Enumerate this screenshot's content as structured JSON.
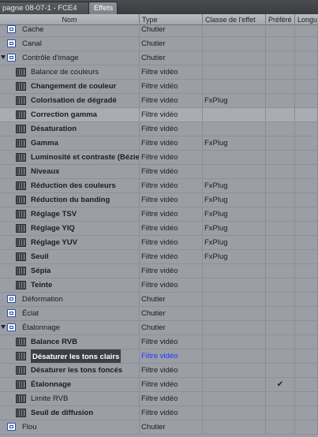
{
  "tabs": [
    {
      "label": "pagne 08-07-1 - FCE4",
      "active": false
    },
    {
      "label": "Effets",
      "active": true
    }
  ],
  "columns": [
    "Nom",
    "Type",
    "Classe de l'effet",
    "Préféré",
    "Longu"
  ],
  "rows": [
    {
      "name": "Cache",
      "type": "Chutier",
      "class": "",
      "pref": "",
      "kind": "bin",
      "level": 0,
      "bold": false
    },
    {
      "name": "Canal",
      "type": "Chutier",
      "class": "",
      "pref": "",
      "kind": "bin",
      "level": 0,
      "bold": false
    },
    {
      "name": "Contrôle d'image",
      "type": "Chutier",
      "class": "",
      "pref": "",
      "kind": "bin-open",
      "level": 0,
      "bold": false
    },
    {
      "name": "Balance de couleurs",
      "type": "Filtre vidéo",
      "class": "",
      "pref": "",
      "kind": "fx",
      "level": 1,
      "bold": false
    },
    {
      "name": "Changement de couleur",
      "type": "Filtre vidéo",
      "class": "",
      "pref": "",
      "kind": "fx",
      "level": 1,
      "bold": true
    },
    {
      "name": "Colorisation de dégradé",
      "type": "Filtre vidéo",
      "class": "FxPlug",
      "pref": "",
      "kind": "fx",
      "level": 1,
      "bold": true
    },
    {
      "name": "Correction gamma",
      "type": "Filtre vidéo",
      "class": "",
      "pref": "",
      "kind": "fx",
      "level": 1,
      "bold": true,
      "hl": true
    },
    {
      "name": "Désaturation",
      "type": "Filtre vidéo",
      "class": "",
      "pref": "",
      "kind": "fx",
      "level": 1,
      "bold": true
    },
    {
      "name": "Gamma",
      "type": "Filtre vidéo",
      "class": "FxPlug",
      "pref": "",
      "kind": "fx",
      "level": 1,
      "bold": true
    },
    {
      "name": "Luminosité et contraste (Bézie",
      "type": "Filtre vidéo",
      "class": "",
      "pref": "",
      "kind": "fx",
      "level": 1,
      "bold": true
    },
    {
      "name": "Niveaux",
      "type": "Filtre vidéo",
      "class": "",
      "pref": "",
      "kind": "fx",
      "level": 1,
      "bold": true
    },
    {
      "name": "Réduction des couleurs",
      "type": "Filtre vidéo",
      "class": "FxPlug",
      "pref": "",
      "kind": "fx",
      "level": 1,
      "bold": true
    },
    {
      "name": "Réduction du banding",
      "type": "Filtre vidéo",
      "class": "FxPlug",
      "pref": "",
      "kind": "fx",
      "level": 1,
      "bold": true
    },
    {
      "name": "Réglage TSV",
      "type": "Filtre vidéo",
      "class": "FxPlug",
      "pref": "",
      "kind": "fx",
      "level": 1,
      "bold": true
    },
    {
      "name": "Réglage YIQ",
      "type": "Filtre vidéo",
      "class": "FxPlug",
      "pref": "",
      "kind": "fx",
      "level": 1,
      "bold": true
    },
    {
      "name": "Réglage YUV",
      "type": "Filtre vidéo",
      "class": "FxPlug",
      "pref": "",
      "kind": "fx",
      "level": 1,
      "bold": true
    },
    {
      "name": "Seuil",
      "type": "Filtre vidéo",
      "class": "FxPlug",
      "pref": "",
      "kind": "fx",
      "level": 1,
      "bold": true
    },
    {
      "name": "Sépia",
      "type": "Filtre vidéo",
      "class": "",
      "pref": "",
      "kind": "fx",
      "level": 1,
      "bold": true
    },
    {
      "name": "Teinte",
      "type": "Filtre vidéo",
      "class": "",
      "pref": "",
      "kind": "fx",
      "level": 1,
      "bold": true
    },
    {
      "name": "Déformation",
      "type": "Chutier",
      "class": "",
      "pref": "",
      "kind": "bin",
      "level": 0,
      "bold": false
    },
    {
      "name": "Éclat",
      "type": "Chutier",
      "class": "",
      "pref": "",
      "kind": "bin",
      "level": 0,
      "bold": false
    },
    {
      "name": "Étalonnage",
      "type": "Chutier",
      "class": "",
      "pref": "",
      "kind": "bin-open",
      "level": 0,
      "bold": false
    },
    {
      "name": "Balance RVB",
      "type": "Filtre vidéo",
      "class": "",
      "pref": "",
      "kind": "fx",
      "level": 1,
      "bold": true
    },
    {
      "name": "Désaturer les tons clairs",
      "type": "Filtre vidéo",
      "class": "",
      "pref": "",
      "kind": "fx",
      "level": 1,
      "bold": true,
      "sel": true
    },
    {
      "name": "Désaturer les tons foncés",
      "type": "Filtre vidéo",
      "class": "",
      "pref": "",
      "kind": "fx",
      "level": 1,
      "bold": true
    },
    {
      "name": "Étalonnage",
      "type": "Filtre vidéo",
      "class": "",
      "pref": "✔",
      "kind": "fx",
      "level": 1,
      "bold": true
    },
    {
      "name": "Limite RVB",
      "type": "Filtre vidéo",
      "class": "",
      "pref": "",
      "kind": "fx",
      "level": 1,
      "bold": false
    },
    {
      "name": "Seuil de diffusion",
      "type": "Filtre vidéo",
      "class": "",
      "pref": "",
      "kind": "fx",
      "level": 1,
      "bold": true
    },
    {
      "name": "Flou",
      "type": "Chutier",
      "class": "",
      "pref": "",
      "kind": "bin",
      "level": 0,
      "bold": false
    }
  ]
}
